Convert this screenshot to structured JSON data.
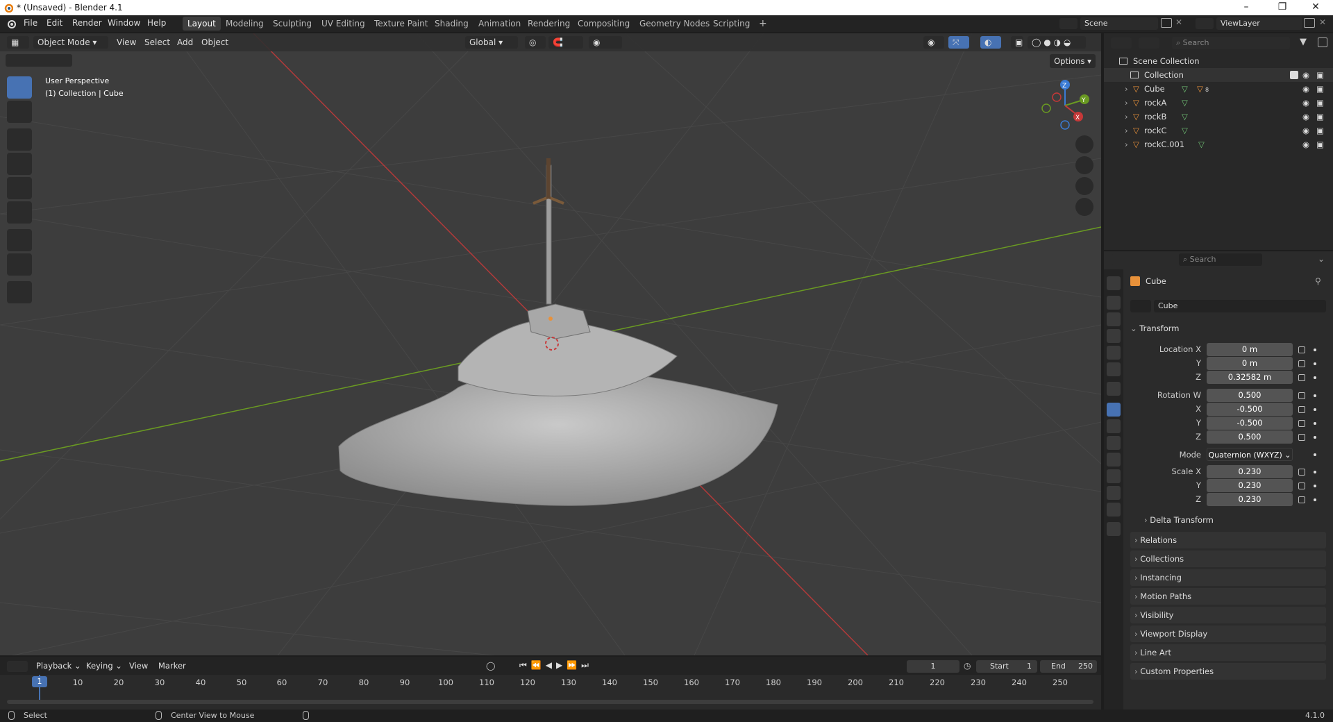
{
  "window": {
    "title": "* (Unsaved) - Blender 4.1"
  },
  "menu": [
    "File",
    "Edit",
    "Render",
    "Window",
    "Help"
  ],
  "workspaces": [
    "Layout",
    "Modeling",
    "Sculpting",
    "UV Editing",
    "Texture Paint",
    "Shading",
    "Animation",
    "Rendering",
    "Compositing",
    "Geometry Nodes",
    "Scripting"
  ],
  "active_workspace": "Layout",
  "scene": {
    "name": "Scene",
    "view_layer": "ViewLayer"
  },
  "viewport_header": {
    "mode": "Object Mode",
    "menus": [
      "View",
      "Select",
      "Add",
      "Object"
    ],
    "orientation": "Global",
    "options_label": "Options"
  },
  "viewport_info": {
    "line1": "User Perspective",
    "line2": "(1) Collection | Cube"
  },
  "gizmo": {
    "x": "X",
    "y": "Y",
    "z": "Z"
  },
  "outliner": {
    "search_placeholder": "Search",
    "root": "Scene Collection",
    "collection": "Collection",
    "objects": [
      {
        "name": "Cube",
        "extra": "8"
      },
      {
        "name": "rockA",
        "extra": ""
      },
      {
        "name": "rockB",
        "extra": ""
      },
      {
        "name": "rockC",
        "extra": ""
      },
      {
        "name": "rockC.001",
        "extra": ""
      }
    ]
  },
  "properties": {
    "search_placeholder": "Search",
    "object_name": "Cube",
    "object_field": "Cube",
    "transform_title": "Transform",
    "location": {
      "label_x": "Location X",
      "label_y": "Y",
      "label_z": "Z",
      "x": "0 m",
      "y": "0 m",
      "z": "0.32582 m"
    },
    "rotation": {
      "label_w": "Rotation W",
      "label_x": "X",
      "label_y": "Y",
      "label_z": "Z",
      "w": "0.500",
      "x": "-0.500",
      "y": "-0.500",
      "z": "0.500"
    },
    "mode_label": "Mode",
    "mode_value": "Quaternion (WXYZ)",
    "scale": {
      "label_x": "Scale X",
      "label_y": "Y",
      "label_z": "Z",
      "x": "0.230",
      "y": "0.230",
      "z": "0.230"
    },
    "delta_transform": "Delta Transform",
    "panels": [
      "Relations",
      "Collections",
      "Instancing",
      "Motion Paths",
      "Visibility",
      "Viewport Display",
      "Line Art",
      "Custom Properties"
    ]
  },
  "timeline": {
    "menus": [
      "Playback",
      "Keying",
      "View",
      "Marker"
    ],
    "current_frame": "1",
    "start_label": "Start",
    "start": "1",
    "end_label": "End",
    "end": "250",
    "ticks": [
      "1",
      "10",
      "20",
      "30",
      "40",
      "50",
      "60",
      "70",
      "80",
      "90",
      "100",
      "110",
      "120",
      "130",
      "140",
      "150",
      "160",
      "170",
      "180",
      "190",
      "200",
      "210",
      "220",
      "230",
      "240",
      "250"
    ]
  },
  "status": {
    "left": "Select",
    "middle": "Center View to Mouse",
    "version": "4.1.0"
  },
  "colors": {
    "accent": "#4772b3",
    "x_axis": "#c63838",
    "y_axis": "#6a9a22",
    "z_axis": "#3a7bd5",
    "object_orange": "#e8913a",
    "mesh_green": "#6fbf73"
  }
}
